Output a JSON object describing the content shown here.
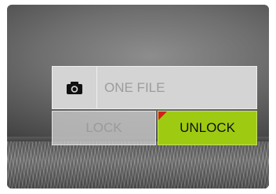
{
  "dialog": {
    "header_icon": "camera-icon",
    "header_label": "ONE FILE"
  },
  "buttons": {
    "lock_label": "LOCK",
    "unlock_label": "UNLOCK",
    "selected": "unlock"
  },
  "colors": {
    "selected_bg": "#9ecb12",
    "selected_marker": "#d2201a",
    "panel_bg": "#d4d4d4",
    "inactive_text": "#9c9c9c"
  }
}
